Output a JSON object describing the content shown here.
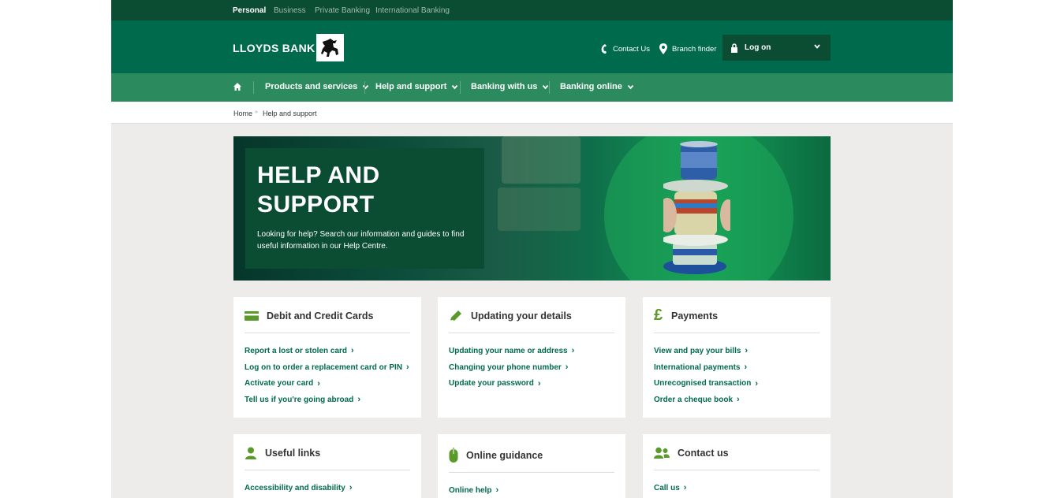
{
  "topbar": {
    "segments": [
      "Personal",
      "Business",
      "Private Banking",
      "International Banking"
    ],
    "active": "Personal"
  },
  "header": {
    "brand": "LLOYDS BANK",
    "contact_label": "Contact Us",
    "branch_label": "Branch finder",
    "logon_label": "Log on"
  },
  "nav": {
    "items": [
      "Products and services",
      "Help and support",
      "Banking with us",
      "Banking online"
    ]
  },
  "breadcrumb": {
    "home": "Home",
    "current": "Help and support"
  },
  "hero": {
    "title": "HELP AND SUPPORT",
    "text": "Looking for help? Search our information and guides to find useful information in our Help Centre."
  },
  "cards": [
    {
      "title": "Debit and Credit Cards",
      "icon": "card-icon",
      "links": [
        "Report a lost or stolen card",
        "Log on to order a replacement card or PIN",
        "Activate your card",
        "Tell us if you're going abroad"
      ]
    },
    {
      "title": "Updating your details",
      "icon": "pencil-icon",
      "links": [
        "Updating your name or address",
        "Changing your phone number",
        "Update your password"
      ]
    },
    {
      "title": "Payments",
      "icon": "pound-icon",
      "links": [
        "View and pay your bills",
        "International payments",
        "Unrecognised transaction",
        "Order a cheque book"
      ]
    },
    {
      "title": "Useful links",
      "icon": "person-icon",
      "links": [
        "Accessibility and disability"
      ]
    },
    {
      "title": "Online guidance",
      "icon": "mouse-icon",
      "links": [
        "Online help"
      ]
    },
    {
      "title": "Contact us",
      "icon": "people-icon",
      "links": [
        "Call us"
      ]
    }
  ],
  "colors": {
    "dark_green": "#0b4d33",
    "brand_green": "#006a4d",
    "nav_green": "#2c8a5f",
    "icon_green": "#5a9a2a",
    "page_bg": "#edecea"
  }
}
